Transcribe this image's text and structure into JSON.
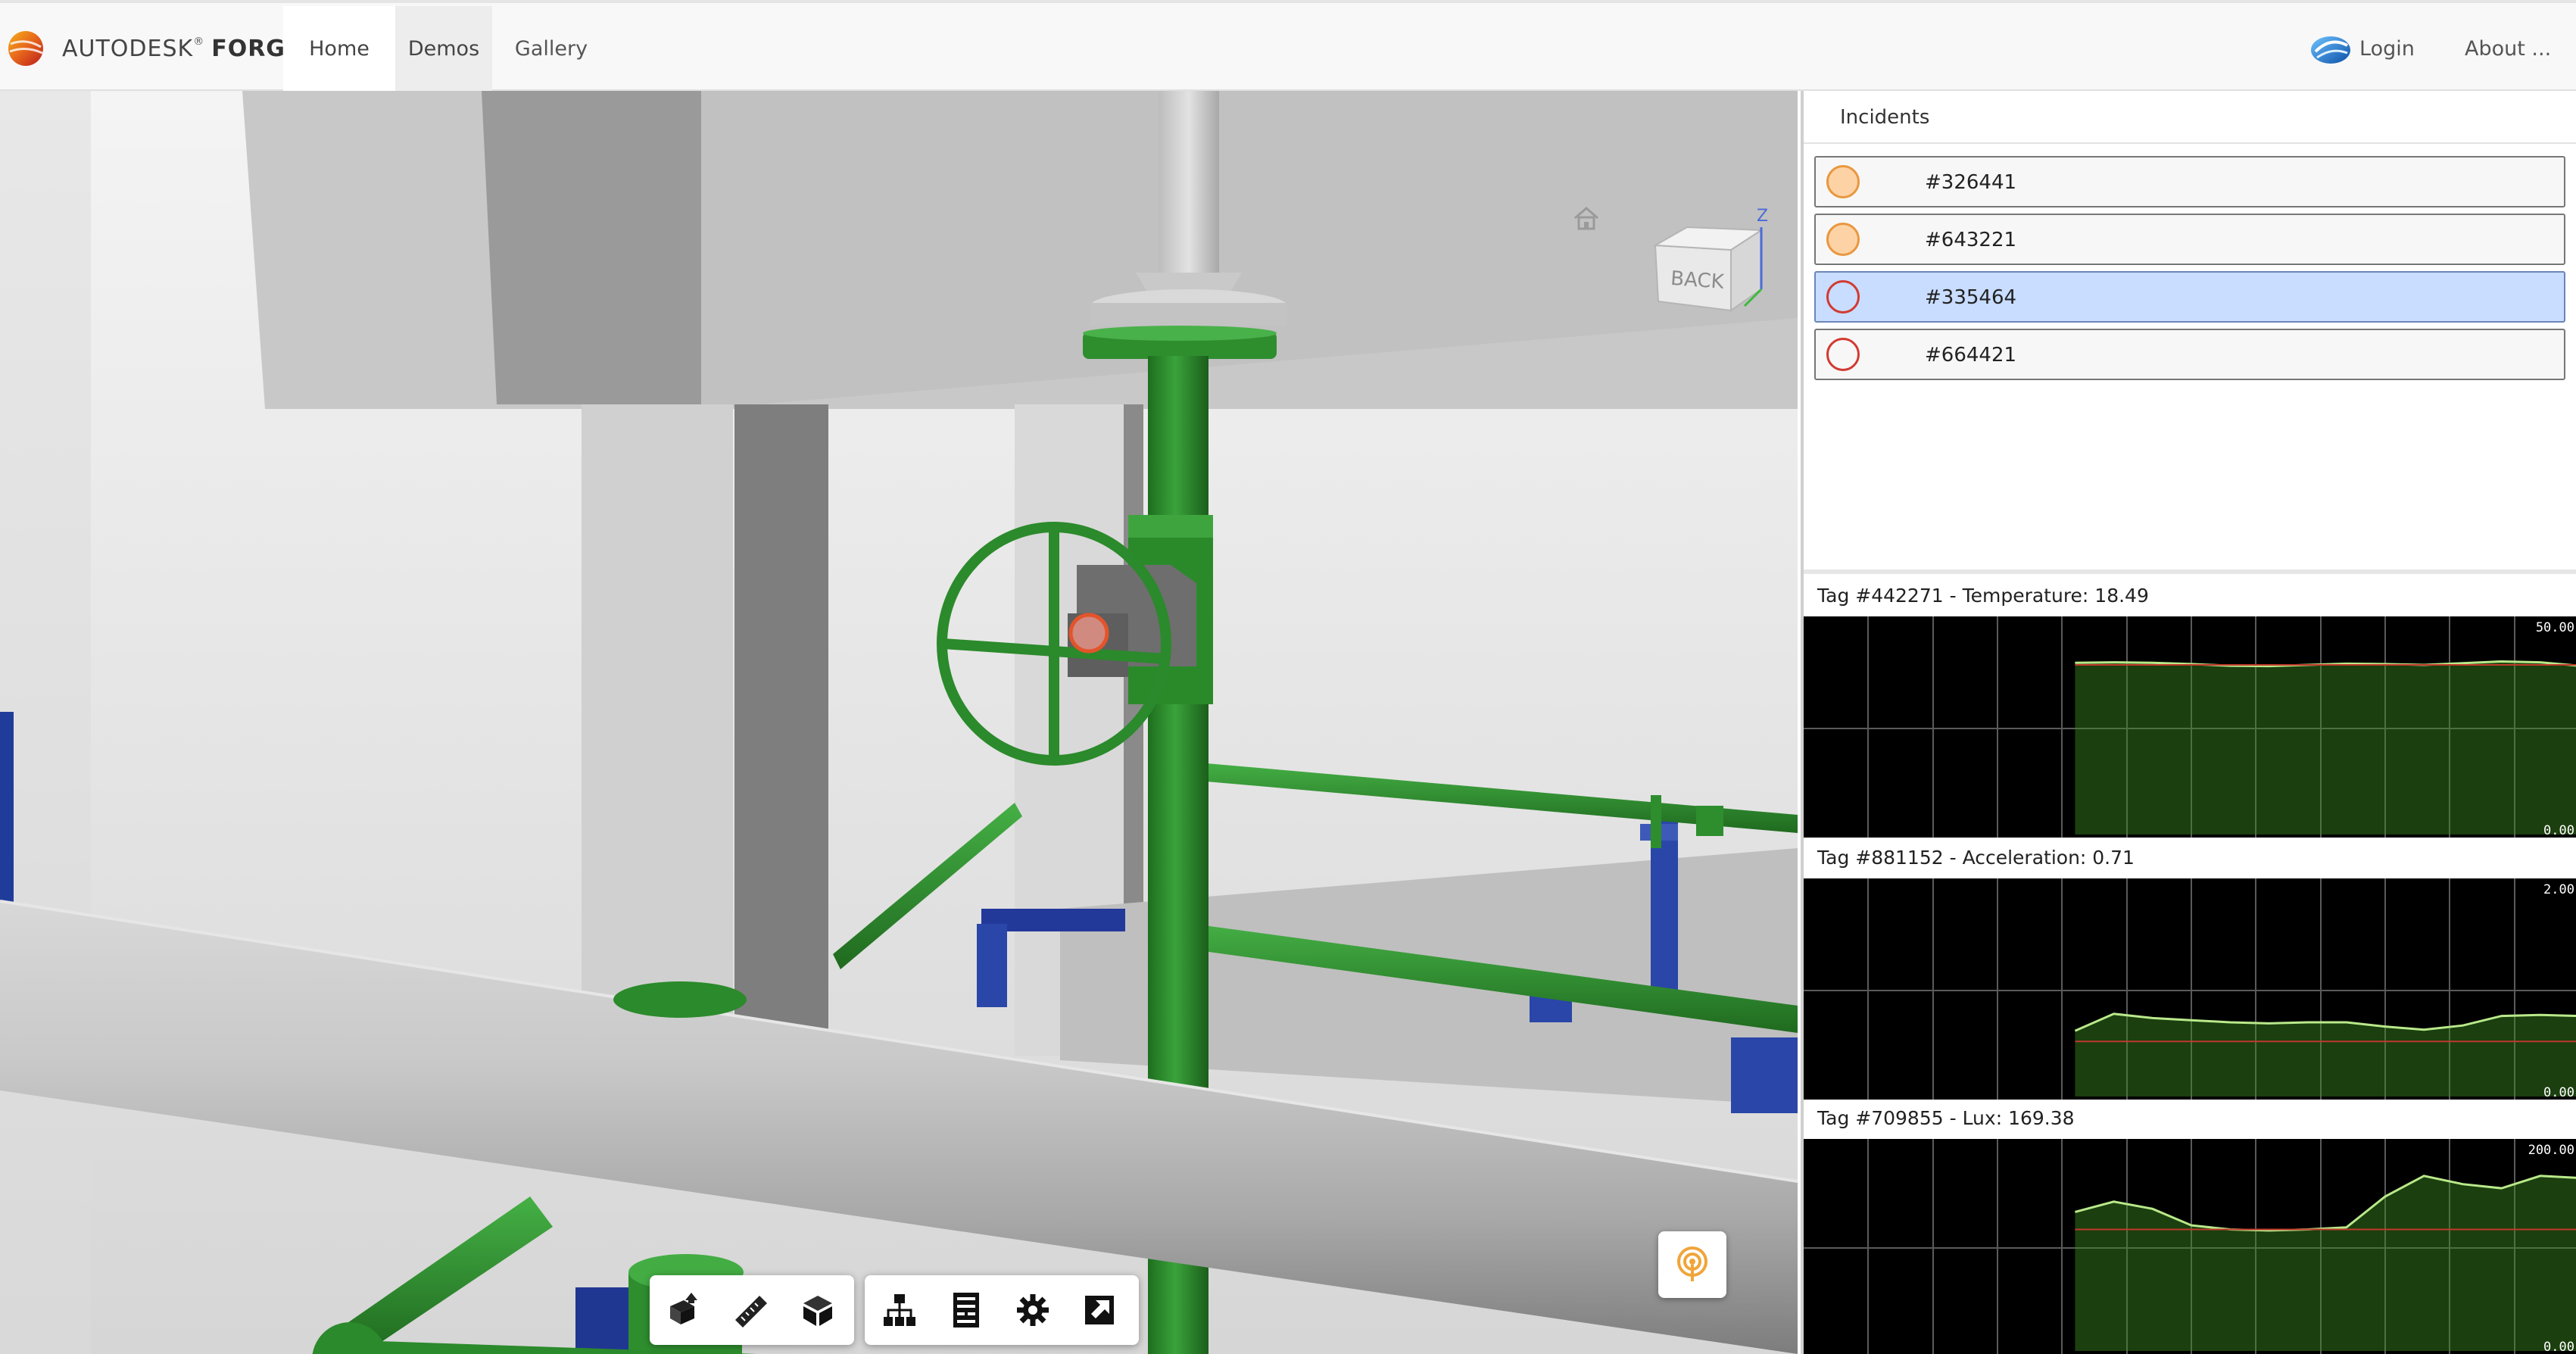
{
  "navbar": {
    "brand_primary": "AUTODESK",
    "brand_mark": "®",
    "brand_secondary": "FORGE",
    "items": [
      {
        "label": "Home"
      },
      {
        "label": "Demos"
      },
      {
        "label": "Gallery"
      }
    ],
    "login_label": "Login",
    "about_label": "About ..."
  },
  "viewer": {
    "viewcube_face": "BACK",
    "viewcube_axis": "Z",
    "toolbar": {
      "group1": [
        "orbit-icon",
        "measure-icon",
        "section-icon"
      ],
      "group2": [
        "model-browser-icon",
        "properties-icon",
        "settings-icon",
        "fullscreen-icon"
      ]
    },
    "sensor_button_icon": "sensor-icon"
  },
  "incidents": {
    "title": "Incidents",
    "items": [
      {
        "label": "#326441",
        "status": "warning",
        "selected": false
      },
      {
        "label": "#643221",
        "status": "warning",
        "selected": false
      },
      {
        "label": "#335464",
        "status": "alert",
        "selected": true
      },
      {
        "label": "#664421",
        "status": "alert",
        "selected": false
      }
    ],
    "colors": {
      "warning": "#e9973e",
      "alert": "#d23a32",
      "selected_bg": "#c8ddff"
    }
  },
  "charts": [
    {
      "title": "Tag #442271 - Temperature: 18.49",
      "ymax_label": "50.00",
      "ymin_label": "0.00"
    },
    {
      "title": "Tag #881152 - Acceleration: 0.71",
      "ymax_label": "2.00",
      "ymin_label": "0.00"
    },
    {
      "title": "Tag #709855 - Lux: 169.38",
      "ymax_label": "200.00",
      "ymin_label": "0.00"
    }
  ],
  "chart_data": [
    {
      "type": "area",
      "title": "Tag #442271 - Temperature: 18.49",
      "ylim": [
        0,
        50
      ],
      "threshold": 40,
      "x": [
        0,
        1,
        2,
        3,
        4,
        5,
        6,
        7,
        8,
        9,
        10,
        11,
        12,
        13,
        14,
        15,
        16,
        17,
        18,
        19,
        20
      ],
      "values": [
        null,
        null,
        null,
        null,
        null,
        null,
        null,
        40.5,
        40.6,
        40.5,
        40.2,
        39.8,
        39.7,
        40.0,
        40.3,
        40.2,
        40.0,
        40.4,
        40.8,
        40.6,
        39.8
      ],
      "grid": true
    },
    {
      "type": "area",
      "title": "Tag #881152 - Acceleration: 0.71",
      "ylim": [
        0,
        2
      ],
      "threshold": 0.52,
      "x": [
        0,
        1,
        2,
        3,
        4,
        5,
        6,
        7,
        8,
        9,
        10,
        11,
        12,
        13,
        14,
        15,
        16,
        17,
        18,
        19,
        20
      ],
      "values": [
        null,
        null,
        null,
        null,
        null,
        null,
        null,
        0.62,
        0.78,
        0.74,
        0.72,
        0.7,
        0.69,
        0.7,
        0.7,
        0.66,
        0.63,
        0.67,
        0.76,
        0.77,
        0.76
      ],
      "grid": true
    },
    {
      "type": "area",
      "title": "Tag #709855 - Lux: 169.38",
      "ylim": [
        0,
        200
      ],
      "threshold": 118,
      "x": [
        0,
        1,
        2,
        3,
        4,
        5,
        6,
        7,
        8,
        9,
        10,
        11,
        12,
        13,
        14,
        15,
        16,
        17,
        18,
        19,
        20
      ],
      "values": [
        null,
        null,
        null,
        null,
        null,
        null,
        null,
        135,
        145,
        138,
        122,
        118,
        117,
        118,
        120,
        150,
        170,
        162,
        158,
        170,
        168
      ],
      "grid": true
    }
  ]
}
